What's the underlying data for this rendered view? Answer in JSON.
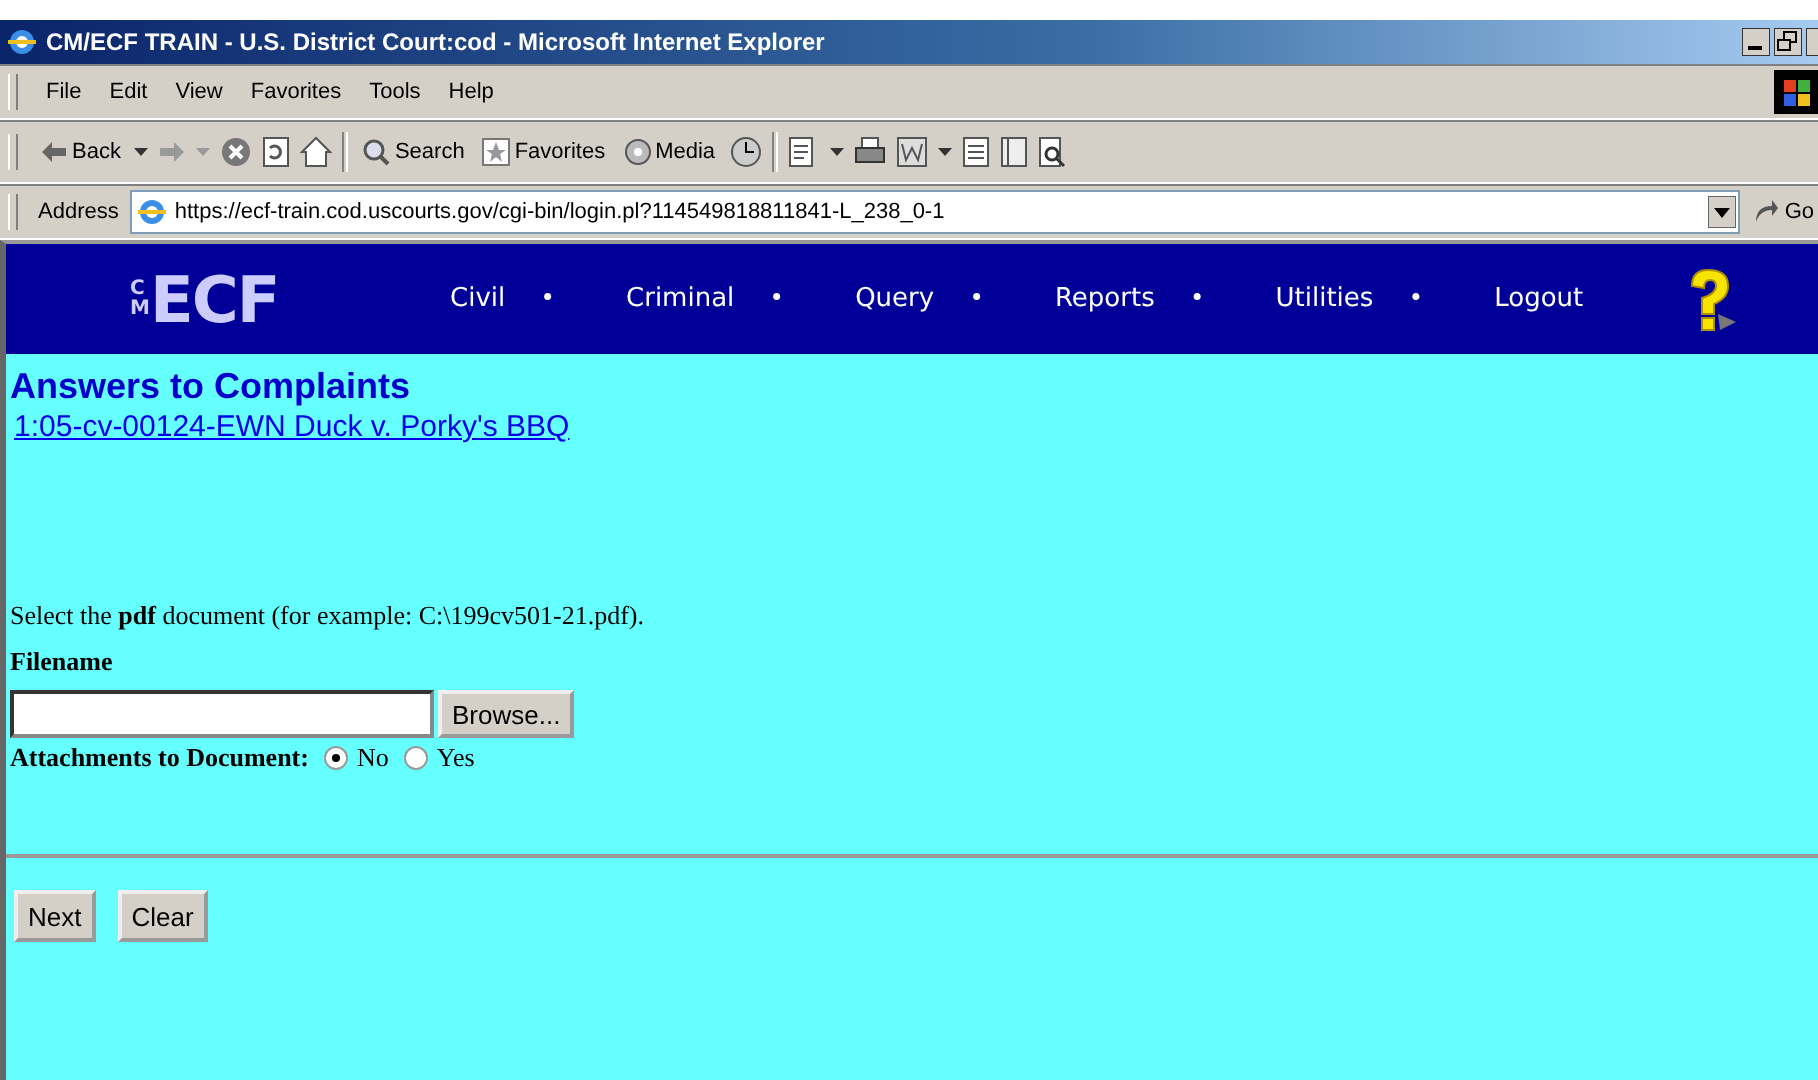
{
  "window": {
    "title": "CM/ECF TRAIN - U.S. District Court:cod - Microsoft Internet Explorer"
  },
  "menu_bar": [
    "File",
    "Edit",
    "View",
    "Favorites",
    "Tools",
    "Help"
  ],
  "toolbar": {
    "back": "Back",
    "search": "Search",
    "favorites": "Favorites",
    "media": "Media"
  },
  "address_bar": {
    "label": "Address",
    "url": "https://ecf-train.cod.uscourts.gov/cgi-bin/login.pl?114549818811841-L_238_0-1",
    "go": "Go"
  },
  "nav": {
    "logo_small": "CM",
    "logo": "ECF",
    "separator": "•",
    "items": [
      "Civil",
      "Criminal",
      "Query",
      "Reports",
      "Utilities",
      "Logout"
    ]
  },
  "content": {
    "heading": "Answers to Complaints",
    "case_link": "1:05-cv-00124-EWN Duck v. Porky's BBQ",
    "instruction": "Select the **pdf** document (for example: C:\\199cv501-21.pdf).",
    "filename_label": "Filename",
    "browse": "Browse...",
    "attachments_label": "Attachments to Document:",
    "attachments": [
      {
        "label": "No",
        "selected": true
      },
      {
        "label": "Yes",
        "selected": false
      }
    ],
    "buttons": [
      "Next",
      "Clear"
    ]
  }
}
